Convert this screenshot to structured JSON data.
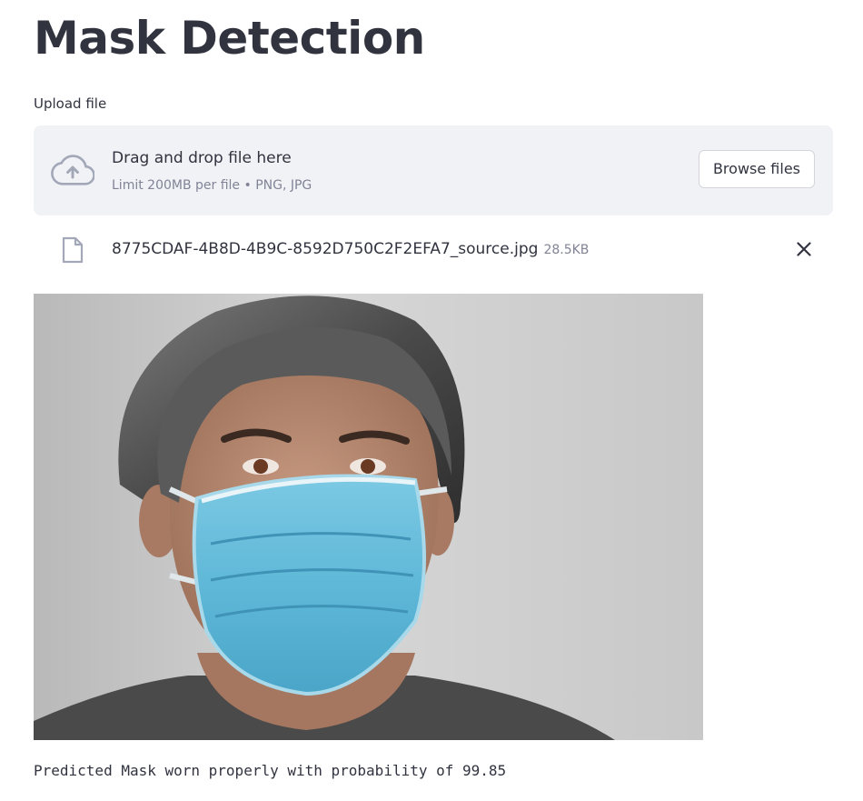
{
  "header": {
    "title": "Mask Detection"
  },
  "uploader": {
    "label": "Upload file",
    "drop_text": "Drag and drop file here",
    "limit_text": "Limit 200MB per file • PNG, JPG",
    "browse_label": "Browse files",
    "icon": "cloud-upload-icon"
  },
  "file": {
    "name": "8775CDAF-4B8D-4B9C-8592D750C2F2EFA7_source.jpg",
    "size": "28.5KB",
    "icon": "file-icon",
    "remove_icon": "close-icon"
  },
  "image": {
    "subject": "woman wearing blue surgical mask"
  },
  "result": {
    "text": "Predicted Mask worn properly with probability of 99.85"
  },
  "colors": {
    "text": "#31333f",
    "muted": "#808495",
    "dropzone_bg": "#f0f2f6",
    "mask_blue": "#5fb8d8"
  }
}
